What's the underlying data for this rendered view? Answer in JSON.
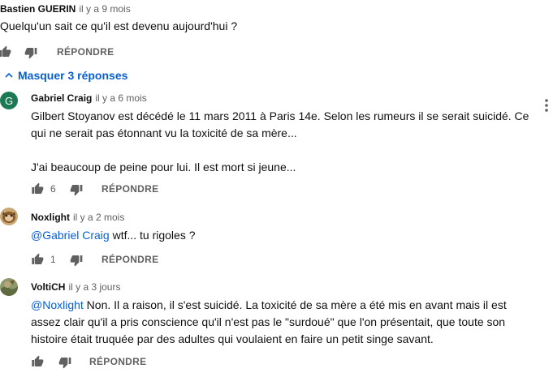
{
  "top_comment": {
    "author": "Bastien GUERIN",
    "time": "il y a 9 mois",
    "text": "Quelqu'un sait ce qu'il est devenu aujourd'hui ?",
    "reply_label": "RÉPONDRE"
  },
  "replies_toggle": {
    "label": "Masquer 3 réponses"
  },
  "replies": [
    {
      "author": "Gabriel Craig",
      "avatar_letter": "G",
      "time": "il y a 6 mois",
      "line1": "Gilbert Stoyanov est décédé le 11 mars 2011 à Paris 14e. Selon les rumeurs il se serait suicidé. Ce",
      "line2": "qui ne serait pas étonnant vu la toxicité de sa mère...",
      "line3": "J'ai beaucoup de peine pour lui. Il est mort si jeune...",
      "likes": "6",
      "reply_label": "RÉPONDRE"
    },
    {
      "author": "Noxlight",
      "time": "il y a 2 mois",
      "mention": "@Gabriel Craig",
      "text": " wtf... tu rigoles ?",
      "likes": "1",
      "reply_label": "RÉPONDRE"
    },
    {
      "author": "VoltiCH",
      "time": "il y a 3 jours",
      "mention": "@Noxlight",
      "line1_rest": " Non. Il a raison, il s'est suicidé. La toxicité de sa mère a été mis en avant mais il est",
      "line2": "assez clair qu'il a pris conscience qu'il n'est pas le \"surdoué\" que l'on présentait, que toute son",
      "line3": "histoire était truquée par des adultes qui voulaient en faire un petit singe savant.",
      "reply_label": "RÉPONDRE"
    }
  ],
  "colors": {
    "link": "#065fd4",
    "secondary": "#606060",
    "avatar_g": "#1b7a55"
  },
  "icons": [
    "thumbs-up-icon",
    "thumbs-down-icon",
    "chevron-up-icon",
    "more-vert-icon"
  ]
}
